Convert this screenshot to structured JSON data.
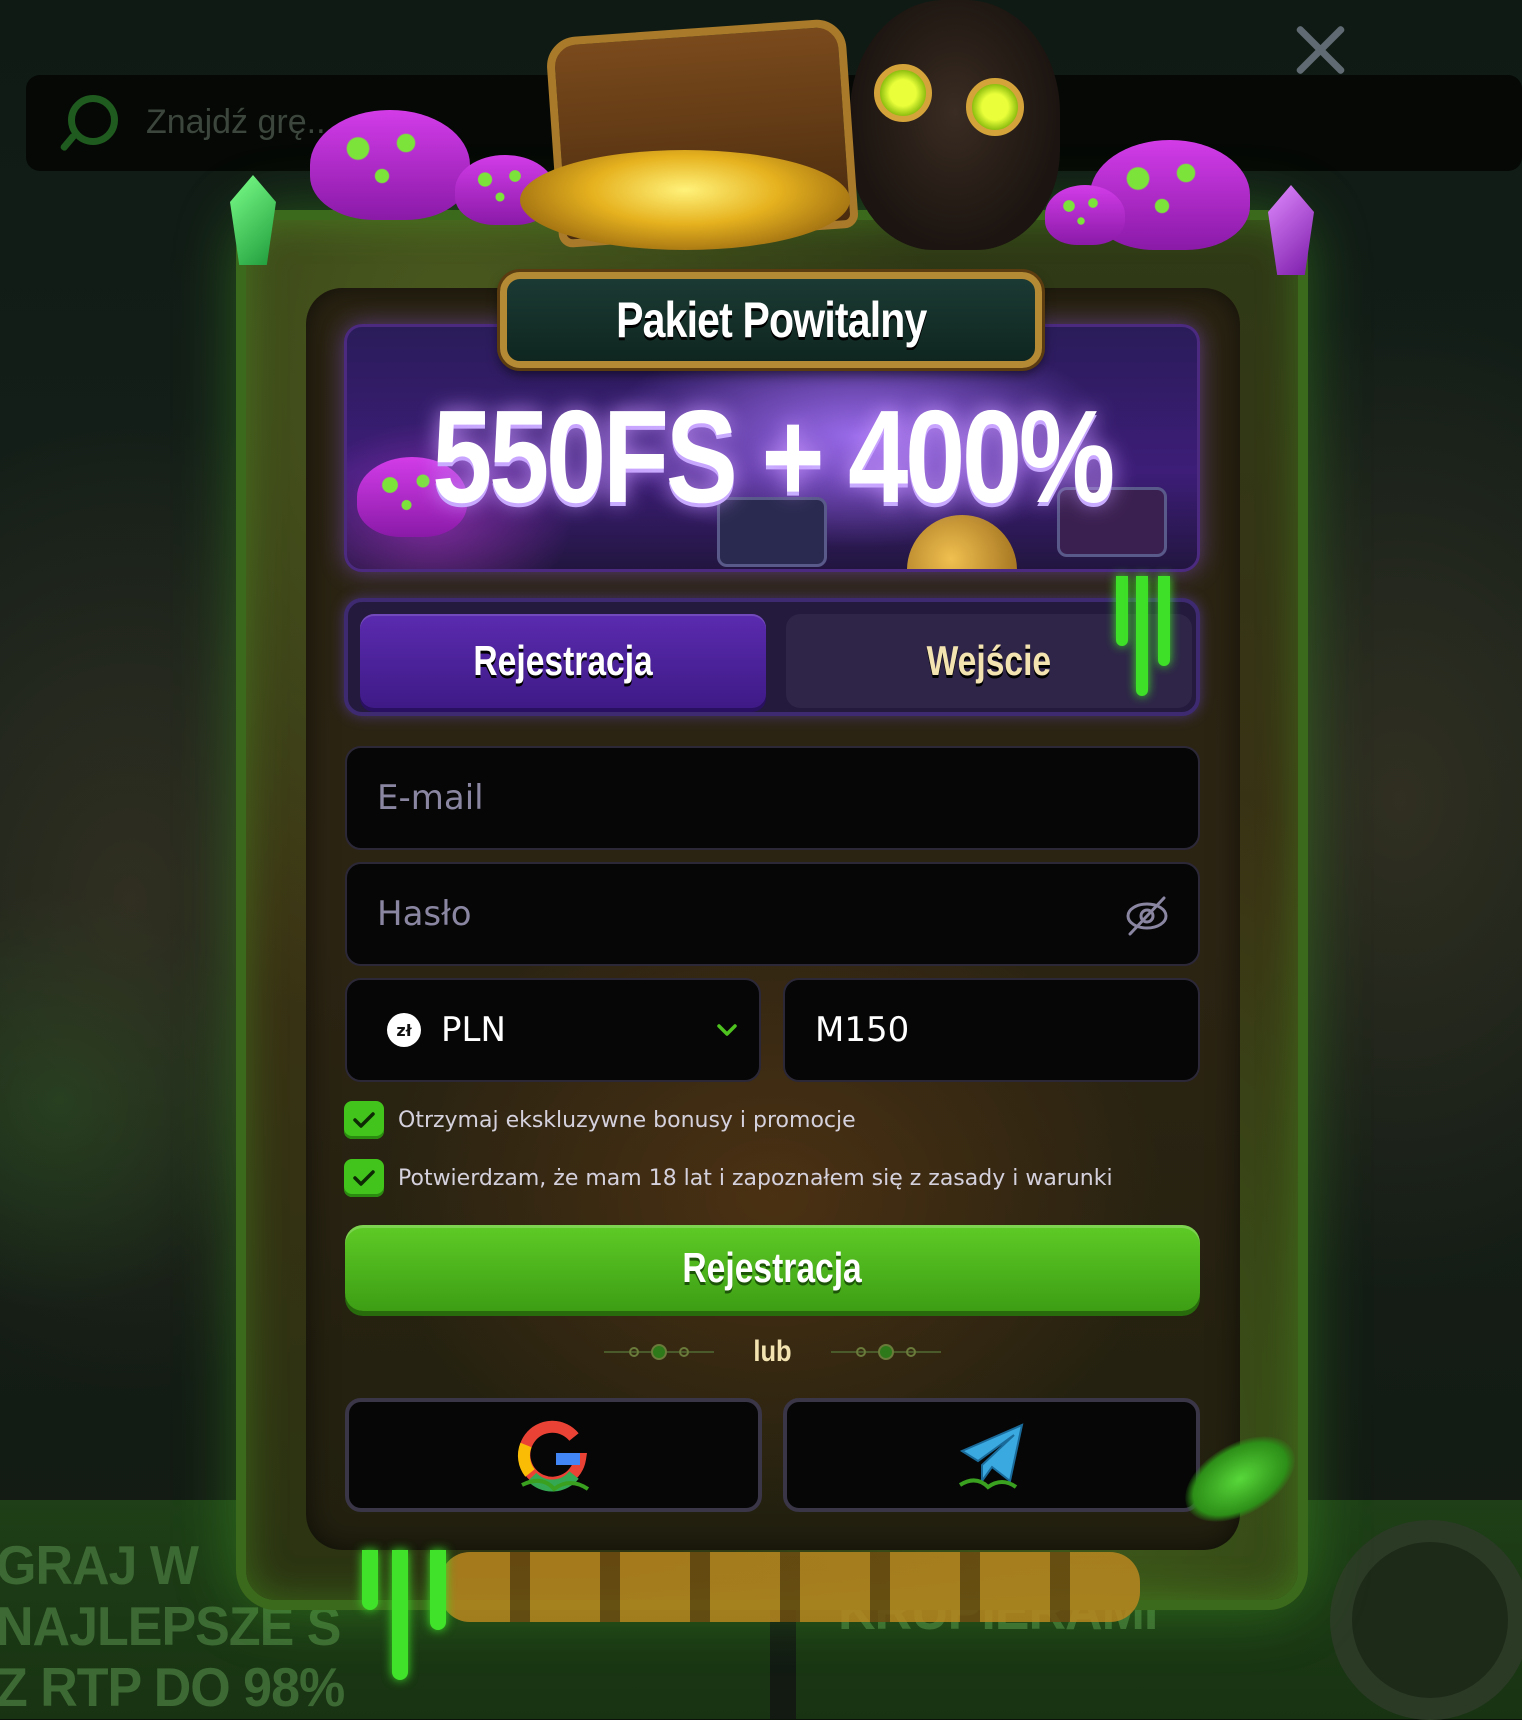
{
  "background": {
    "search_placeholder": "Znajdź grę...",
    "banner_left_lines": [
      "GRAJ W",
      "NAJLEPSZE S",
      "Z RTP DO 98%"
    ],
    "banner_right_lines": [
      "KRUPIERAMI"
    ]
  },
  "modal": {
    "title": "Pakiet Powitalny",
    "promo_amount": "550FS + 400%",
    "tabs": [
      {
        "label": "Rejestracja",
        "active": true
      },
      {
        "label": "Wejście",
        "active": false
      }
    ],
    "email": {
      "placeholder": "E-mail",
      "value": ""
    },
    "password": {
      "placeholder": "Hasło",
      "value": ""
    },
    "currency": {
      "selected": "PLN",
      "icon": "zł"
    },
    "promo_code": {
      "value": "M150"
    },
    "checkboxes": [
      {
        "label": "Otrzymaj ekskluzywne bonusy i promocje",
        "checked": true
      },
      {
        "label": "Potwierdzam, że mam 18 lat i zapoznałem się z zasady i warunki",
        "checked": true
      }
    ],
    "submit_label": "Rejestracja",
    "or_label": "lub",
    "social": [
      {
        "name": "google-icon"
      },
      {
        "name": "telegram-icon"
      }
    ]
  },
  "colors": {
    "accent_green": "#43c41d",
    "accent_purple": "#5b2bb0",
    "cream_text": "#f3e3b0"
  }
}
